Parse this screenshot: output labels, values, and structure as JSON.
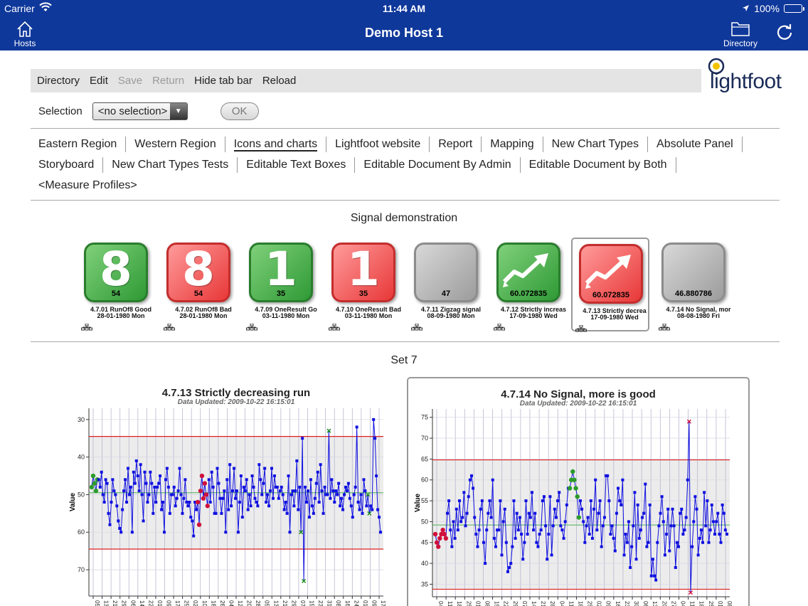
{
  "status": {
    "carrier": "Carrier",
    "time": "11:44 AM",
    "battery": "100%"
  },
  "nav": {
    "title": "Demo Host 1",
    "hosts_label": "Hosts",
    "directory_label": "Directory"
  },
  "toolbar": {
    "directory": "Directory",
    "edit": "Edit",
    "save": "Save",
    "return": "Return",
    "hide_tab_bar": "Hide tab bar",
    "reload": "Reload"
  },
  "logo": {
    "text": "lightfoot"
  },
  "selection": {
    "label": "Selection",
    "value": "<no selection>",
    "ok": "OK"
  },
  "tabs": [
    [
      "Eastern Region",
      "Western Region",
      "Icons and charts",
      "Lightfoot website",
      "Report",
      "Mapping",
      "New Chart Types",
      "Absolute Panel"
    ],
    [
      "Storyboard",
      "New Chart Types Tests",
      "Editable Text Boxes",
      "Editable Document By Admin",
      "Editable Document by Both"
    ],
    [
      "<Measure Profiles>"
    ]
  ],
  "active_tab": "Icons and charts",
  "signal_title": "Signal demonstration",
  "tiles": [
    {
      "big": "8",
      "value": "54",
      "color": "green",
      "label1": "4.7.01 RunOf8 Good",
      "label2": "28-01-1980 Mon"
    },
    {
      "big": "8",
      "value": "54",
      "color": "red",
      "label1": "4.7.02 RunOf8 Bad",
      "label2": "28-01-1980 Mon"
    },
    {
      "big": "1",
      "value": "35",
      "color": "green",
      "label1": "4.7.09 OneResult Go",
      "label2": "03-11-1980 Mon"
    },
    {
      "big": "1",
      "value": "35",
      "color": "red",
      "label1": "4.7.10 OneResult Bad",
      "label2": "03-11-1980 Mon"
    },
    {
      "big": "",
      "value": "47",
      "color": "grey",
      "label1": "4.7.11 Zigzag signal",
      "label2": "08-09-1980 Mon"
    },
    {
      "big": "arrow",
      "value": "60.072835",
      "color": "green",
      "label1": "4.7.12 Strictly increas",
      "label2": "17-09-1980 Wed"
    },
    {
      "big": "arrow",
      "value": "60.072835",
      "color": "red",
      "label1": "4.7.13 Strictly decrea",
      "label2": "17-09-1980 Wed",
      "selected": true
    },
    {
      "big": "",
      "value": "46.880786",
      "color": "grey",
      "label1": "4.7.14 No Signal, mor",
      "label2": "08-08-1980 Fri"
    }
  ],
  "set_title": "Set 7",
  "charts": [
    {
      "title": "4.7.13 Strictly decreasing run",
      "subtitle": "Data Updated: 2009-10-22 16:15:01",
      "ylabel": "Value",
      "yticks": [
        30,
        40,
        50,
        60,
        70
      ],
      "ylim": [
        27,
        77
      ],
      "inverted": true,
      "ucl": 34.5,
      "lcl": 64.5,
      "mean": 49.5,
      "xticks": [
        "05-01-1980",
        "13-01-1980",
        "21-01-1980",
        "29-01-1980",
        "06-02-1980",
        "14-02-1980",
        "22-02-1980",
        "01-03-1980",
        "09-03-1980",
        "17-03-1980",
        "25-03-1980",
        "02-04-1980",
        "10-04-1980",
        "18-04-1980",
        "26-04-1980",
        "04-05-1980",
        "12-05-1980",
        "20-05-1980",
        "28-05-1980",
        "05-06-1980",
        "13-06-1980",
        "21-06-1980",
        "29-06-1980",
        "07-07-1980",
        "15-07-1980",
        "23-07-1980",
        "31-07-1980",
        "08-08-1980",
        "16-08-1980",
        "24-08-1980",
        "01-09-1980",
        "09-09-1980",
        "17-09-1980"
      ],
      "values": [
        48,
        45,
        47,
        49,
        46,
        46,
        48,
        44,
        50,
        52,
        46,
        47,
        55,
        58,
        52,
        46,
        49,
        50,
        53,
        57,
        59,
        60,
        54,
        49,
        46,
        52,
        43,
        50,
        48,
        60,
        44,
        47,
        41,
        45,
        49,
        42,
        50,
        57,
        44,
        47,
        52,
        50,
        44,
        47,
        55,
        48,
        52,
        48,
        47,
        45,
        54,
        52,
        60,
        46,
        43,
        48,
        55,
        50,
        50,
        48,
        53,
        51,
        49,
        43,
        50,
        55,
        51,
        46,
        52,
        53,
        52,
        56,
        57,
        61,
        52,
        54,
        52,
        58,
        49,
        45,
        51,
        47,
        50,
        53,
        46,
        52,
        44,
        48,
        55,
        55,
        43,
        47,
        51,
        55,
        51,
        49,
        60,
        46,
        54,
        42,
        53,
        49,
        43,
        51,
        49,
        60,
        52,
        45,
        56,
        48,
        49,
        46,
        54,
        50,
        53,
        45,
        48,
        51,
        52,
        53,
        42,
        46,
        50,
        47,
        43,
        52,
        50,
        53,
        49,
        43,
        51,
        45,
        48,
        48,
        51,
        49,
        48,
        50,
        54,
        52,
        55,
        45,
        60,
        50,
        49,
        53,
        49,
        41,
        54,
        48,
        60,
        35,
        73,
        48,
        52,
        49,
        56,
        46,
        53,
        55,
        51,
        47,
        44,
        52,
        42,
        49,
        55,
        48,
        50,
        50,
        33,
        51,
        46,
        49,
        52,
        49,
        50,
        47,
        53,
        51,
        54,
        50,
        48,
        49,
        47,
        51,
        53,
        56,
        50,
        48,
        32,
        52,
        54,
        50,
        55,
        46,
        49,
        53,
        50,
        55,
        53,
        54,
        30,
        35,
        45,
        54,
        56,
        60
      ],
      "green_idx": [
        0,
        1,
        2,
        3,
        4
      ],
      "red_idx": [
        76,
        77,
        78,
        79,
        80,
        81,
        82,
        83
      ],
      "star_idx": [
        150,
        152,
        170,
        198,
        199
      ]
    },
    {
      "title": "4.7.14 No Signal, more is good",
      "subtitle": "Data Updated: 2009-10-22 16:15:01",
      "ylabel": "Value",
      "yticks": [
        35,
        40,
        45,
        50,
        55,
        60,
        65,
        70,
        75
      ],
      "ylim": [
        32,
        77
      ],
      "inverted": false,
      "ucl": 64.8,
      "lcl": 33.8,
      "mean": 49.2,
      "xticks": [
        "04-01-1980",
        "11-01-1980",
        "18-01-1980",
        "25-01-1980",
        "01-02-1980",
        "08-02-1980",
        "15-02-1980",
        "22-02-1980",
        "29-02-1980",
        "07-03-1980",
        "14-03-1980",
        "21-03-1980",
        "28-03-1980",
        "04-04-1980",
        "11-04-1980",
        "18-04-1980",
        "25-04-1980",
        "02-05-1980",
        "09-05-1980",
        "16-05-1980",
        "23-05-1980",
        "30-05-1980",
        "06-06-1980",
        "13-06-1980",
        "20-06-1980",
        "27-06-1980",
        "04-07-1980",
        "11-07-1980",
        "18-07-1980",
        "25-07-1980",
        "01-08-1980",
        "08-08-1980"
      ],
      "values": [
        47,
        45,
        44,
        46,
        47,
        48,
        47,
        46,
        52,
        55,
        48,
        44,
        50,
        46,
        53,
        48,
        55,
        50,
        51,
        57,
        49,
        52,
        56,
        60,
        61,
        58,
        51,
        47,
        44,
        48,
        53,
        55,
        45,
        40,
        48,
        52,
        55,
        51,
        60,
        46,
        44,
        48,
        48,
        55,
        42,
        50,
        53,
        45,
        38,
        39,
        40,
        44,
        55,
        46,
        52,
        48,
        51,
        47,
        41,
        45,
        55,
        47,
        52,
        51,
        57,
        48,
        52,
        45,
        44,
        47,
        48,
        55,
        56,
        49,
        41,
        47,
        56,
        42,
        49,
        53,
        51,
        55,
        57,
        49,
        48,
        46,
        50,
        54,
        58,
        58,
        60,
        62,
        60,
        58,
        56,
        51,
        55,
        53,
        50,
        45,
        49,
        51,
        47,
        55,
        46,
        53,
        60,
        48,
        52,
        55,
        44,
        49,
        51,
        61,
        61,
        55,
        47,
        49,
        46,
        43,
        52,
        58,
        55,
        54,
        60,
        42,
        47,
        45,
        50,
        39,
        44,
        49,
        57,
        41,
        54,
        46,
        48,
        51,
        52,
        59,
        44,
        45,
        54,
        37,
        41,
        37,
        36,
        45,
        49,
        52,
        56,
        50,
        42,
        47,
        53,
        43,
        49,
        53,
        49,
        39,
        45,
        44,
        52,
        53,
        47,
        48,
        51,
        60,
        74,
        33,
        44,
        50,
        56,
        53,
        42,
        46,
        48,
        45,
        57,
        49,
        55,
        45,
        48,
        54,
        50,
        47,
        50,
        52,
        47,
        45,
        54,
        52,
        48,
        47
      ],
      "green_idx": [
        89,
        90,
        91,
        92,
        93,
        94,
        95
      ],
      "red_idx": [
        0,
        1,
        2,
        3,
        4,
        5,
        6,
        7
      ],
      "star_idx": [
        168,
        169
      ]
    }
  ],
  "colors": {
    "nav": "#0f389b",
    "point": "#1010e0",
    "good": "#2a9a2a",
    "bad": "#d0103a",
    "limit": "#e02020"
  }
}
